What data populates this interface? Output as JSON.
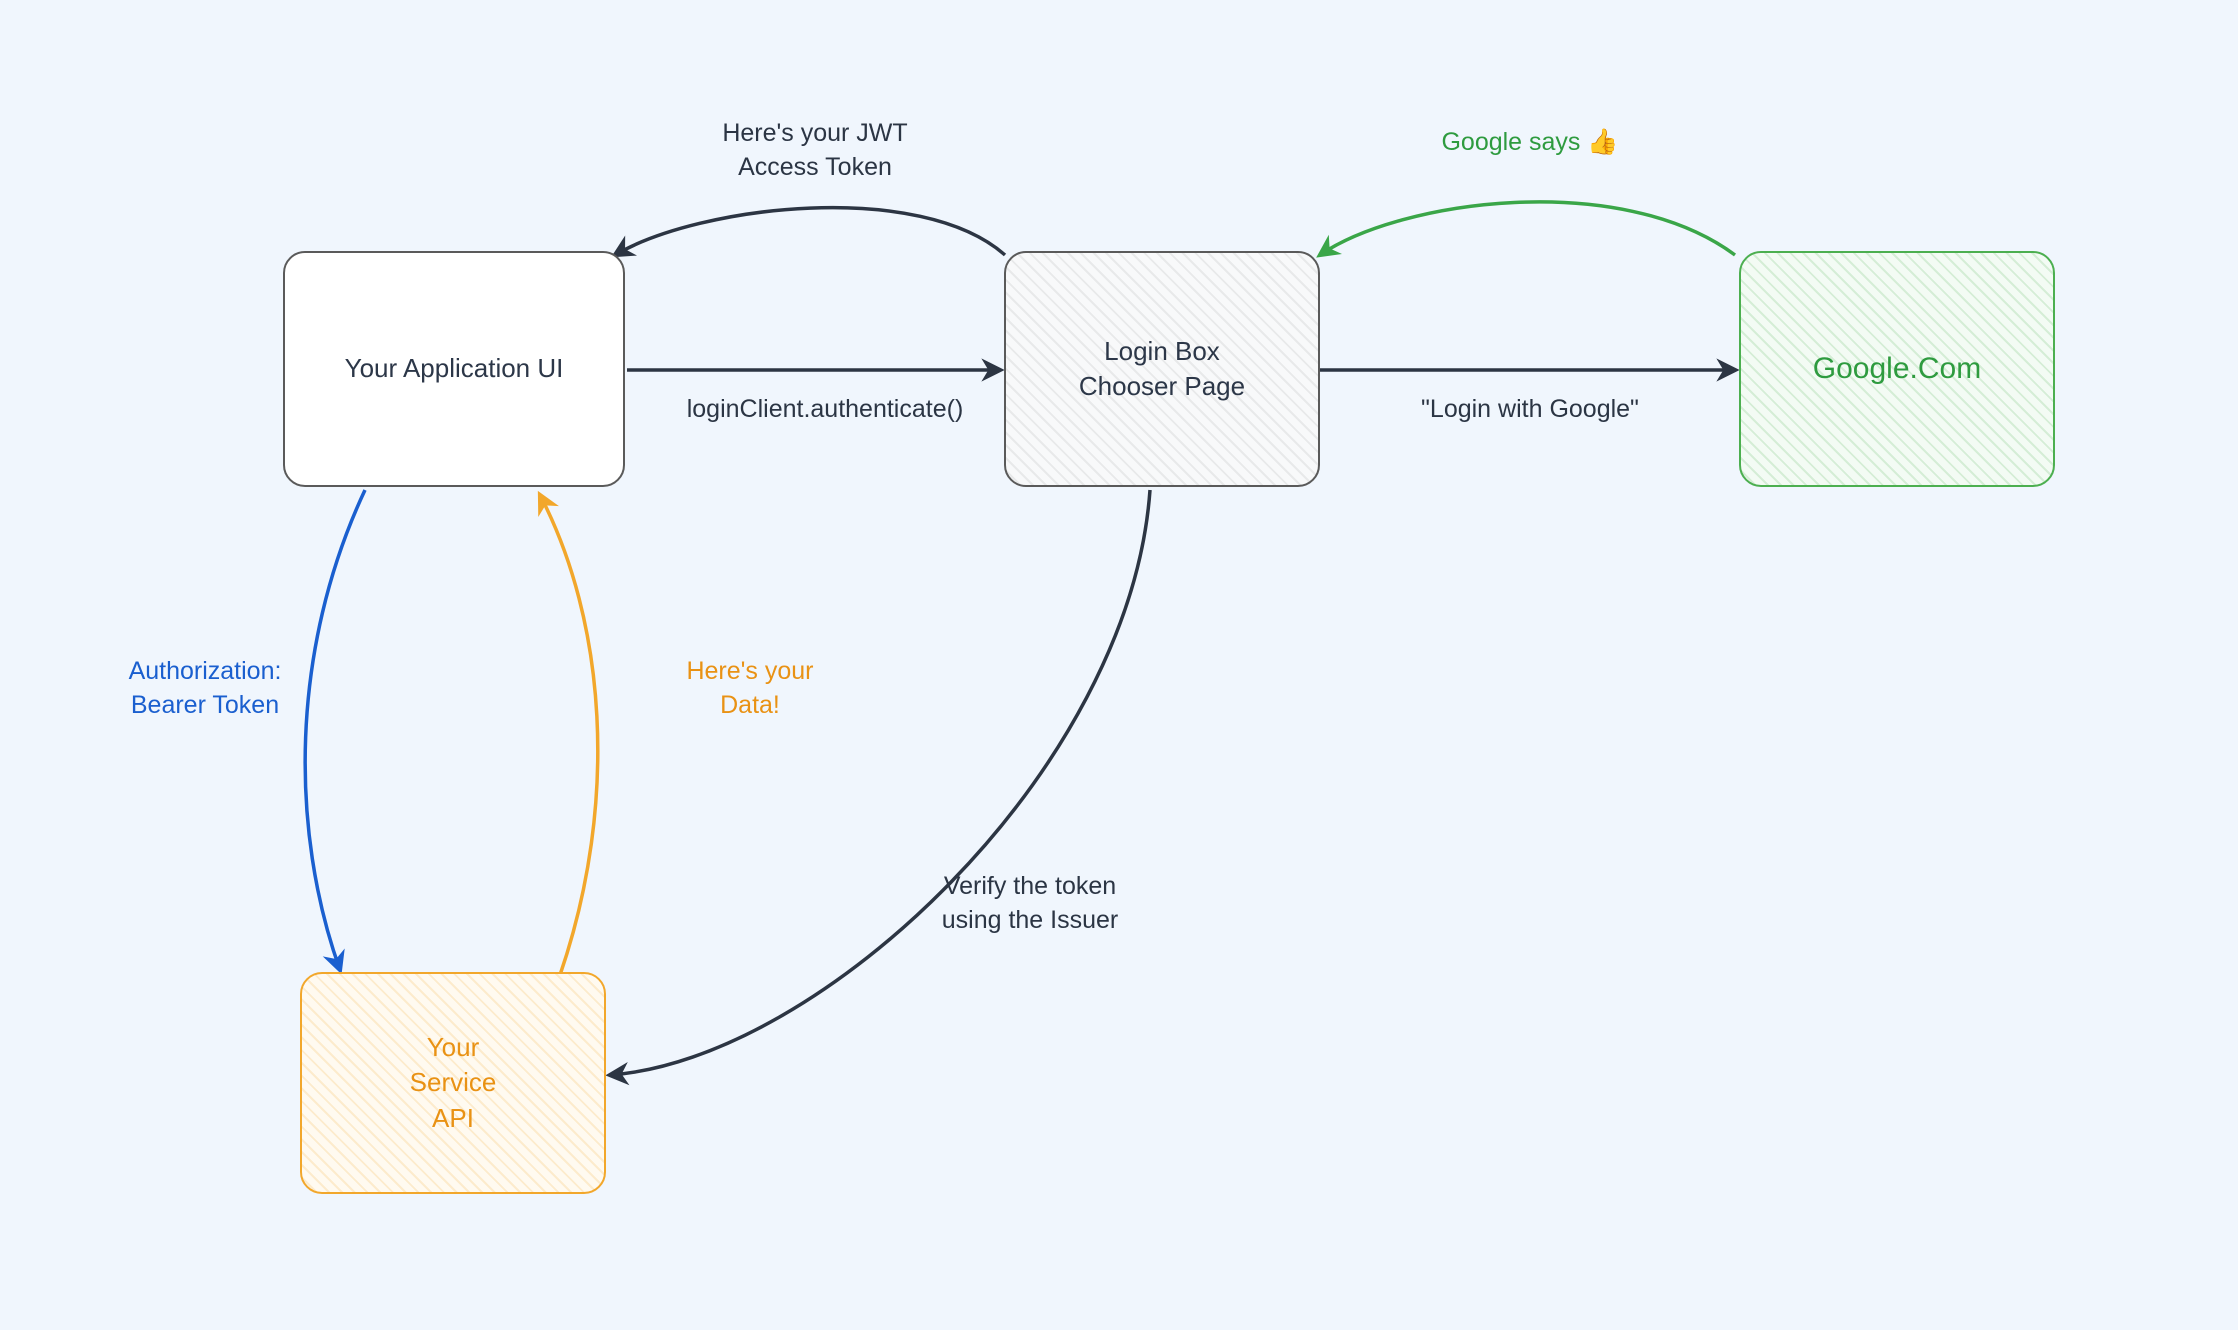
{
  "nodes": {
    "app_ui": {
      "label": "Your Application UI"
    },
    "login_box": {
      "label": "Login Box\nChooser Page"
    },
    "google": {
      "label": "Google.Com"
    },
    "service_api": {
      "label": "Your\nService\nAPI"
    }
  },
  "edges": {
    "jwt_token": {
      "label": "Here's your JWT\nAccess Token"
    },
    "authenticate": {
      "label": "loginClient.authenticate()"
    },
    "login_with_google": {
      "label": "\"Login with Google\""
    },
    "google_says": {
      "label": "Google says 👍"
    },
    "verify_token": {
      "label": "Verify the token\nusing the Issuer"
    },
    "bearer_token": {
      "label": "Authorization:\nBearer Token"
    },
    "heres_data": {
      "label": "Here's your\nData!"
    }
  },
  "colors": {
    "dark": "#2c3543",
    "green": "#3aa648",
    "orange": "#f2a72b",
    "blue": "#1a5fcf"
  }
}
